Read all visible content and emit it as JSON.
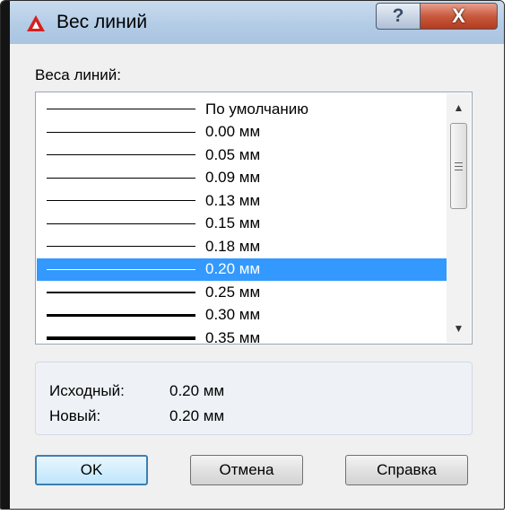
{
  "window": {
    "title": "Вес линий",
    "help_glyph": "?",
    "close_glyph": "X"
  },
  "list": {
    "label": "Веса линий:",
    "items": [
      {
        "label": "По умолчанию",
        "weight": "default"
      },
      {
        "label": "0.00 мм",
        "weight": 0.0
      },
      {
        "label": "0.05 мм",
        "weight": 0.05
      },
      {
        "label": "0.09 мм",
        "weight": 0.09
      },
      {
        "label": "0.13 мм",
        "weight": 0.13
      },
      {
        "label": "0.15 мм",
        "weight": 0.15
      },
      {
        "label": "0.18 мм",
        "weight": 0.18
      },
      {
        "label": "0.20 мм",
        "weight": 0.2,
        "selected": true
      },
      {
        "label": "0.25 мм",
        "weight": 0.25
      },
      {
        "label": "0.30 мм",
        "weight": 0.3
      },
      {
        "label": "0.35 мм",
        "weight": 0.35
      }
    ]
  },
  "info": {
    "original_label": "Исходный:",
    "original_value": "0.20 мм",
    "new_label": "Новый:",
    "new_value": "0.20 мм"
  },
  "buttons": {
    "ok": "OK",
    "cancel": "Отмена",
    "help": "Справка"
  },
  "colors": {
    "selection": "#3399ff",
    "title_bar": "#b3cce6",
    "close_button": "#c85a3e",
    "app_icon": "#d42020"
  },
  "icons": {
    "app": "autocad-logo-icon",
    "help": "question-icon",
    "close": "close-icon",
    "scroll_up": "arrow-up-icon",
    "scroll_down": "arrow-down-icon",
    "thumb_grip": "grip-icon"
  }
}
